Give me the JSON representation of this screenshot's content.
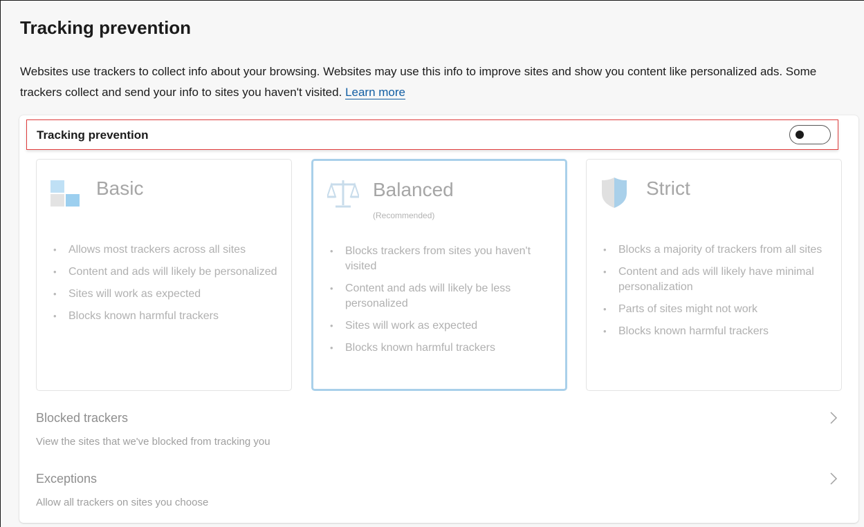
{
  "header": {
    "title": "Tracking prevention",
    "description": "Websites use trackers to collect info about your browsing. Websites may use this info to improve sites and show you content like personalized ads. Some trackers collect and send your info to sites you haven't visited.",
    "learn_more": "Learn more"
  },
  "toggle_row": {
    "label": "Tracking prevention",
    "state": "off"
  },
  "options": [
    {
      "title": "Basic",
      "subtitle": "",
      "icon": "basic-squares-icon",
      "items": [
        "Allows most trackers across all sites",
        "Content and ads will likely be personalized",
        "Sites will work as expected",
        "Blocks known harmful trackers"
      ]
    },
    {
      "title": "Balanced",
      "subtitle": "(Recommended)",
      "icon": "scale-icon",
      "selected": true,
      "items": [
        "Blocks trackers from sites you haven't visited",
        "Content and ads will likely be less personalized",
        "Sites will work as expected",
        "Blocks known harmful trackers"
      ]
    },
    {
      "title": "Strict",
      "subtitle": "",
      "icon": "shield-icon",
      "items": [
        "Blocks a majority of trackers from all sites",
        "Content and ads will likely have minimal personalization",
        "Parts of sites might not work",
        "Blocks known harmful trackers"
      ]
    }
  ],
  "blocked_trackers": {
    "title": "Blocked trackers",
    "description": "View the sites that we've blocked from tracking you"
  },
  "exceptions": {
    "title": "Exceptions",
    "description": "Allow all trackers on sites you choose"
  },
  "colors": {
    "link": "#115ea3",
    "highlight_border": "#e03b3b",
    "selected_border": "#a9d0ea",
    "icon_blue": "#a9d0ea"
  }
}
